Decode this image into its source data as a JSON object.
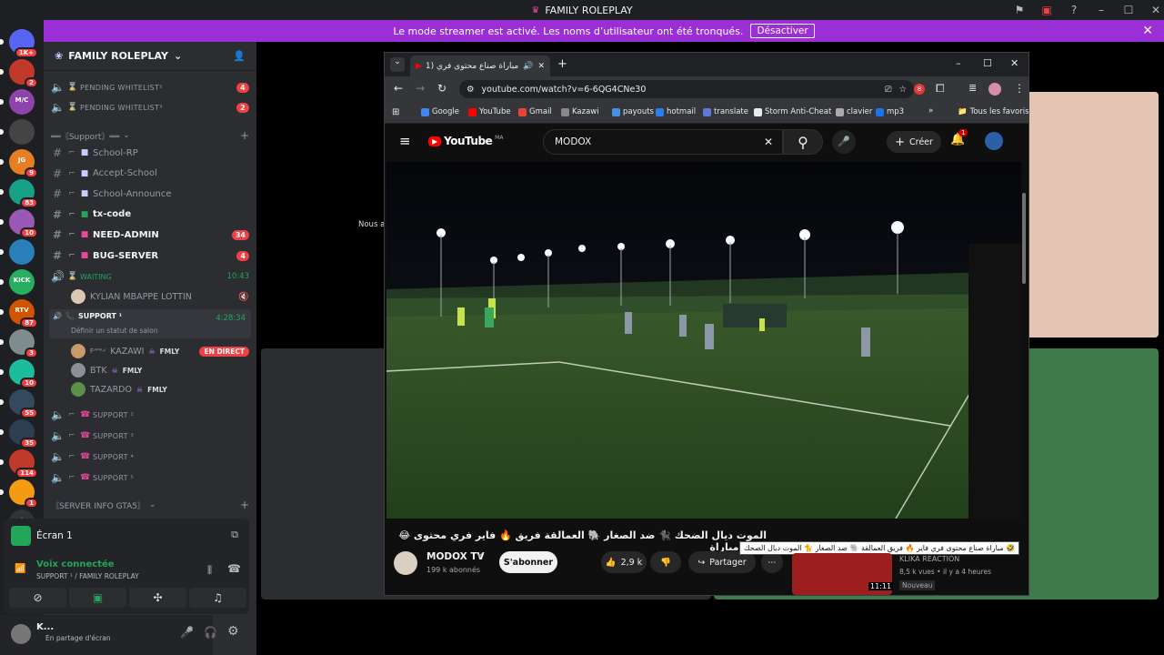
{
  "window": {
    "title": "FAMILY ROLEPLAY",
    "controls": [
      "minimize",
      "maximize",
      "close"
    ]
  },
  "banner": {
    "text": "Le mode streamer est activé. Les noms d’utilisateur ont été tronqués.",
    "button": "Désactiver"
  },
  "guilds": [
    {
      "badge": "1K+",
      "color": "#5865f2"
    },
    {
      "badge": "2",
      "color": "#c0392b"
    },
    {
      "badge": "",
      "color": "#8e44ad",
      "label": "M/C"
    },
    {
      "badge": "",
      "color": "#444"
    },
    {
      "badge": "9",
      "color": "#e67e22",
      "label": "JG"
    },
    {
      "badge": "83",
      "color": "#16a085"
    },
    {
      "badge": "10",
      "color": "#9b59b6"
    },
    {
      "badge": "",
      "color": "#2980b9"
    },
    {
      "badge": "",
      "color": "#27ae60",
      "label": "KICK"
    },
    {
      "badge": "87",
      "color": "#d35400",
      "label": "RTV"
    },
    {
      "badge": "3",
      "color": "#7f8c8d"
    },
    {
      "badge": "10",
      "color": "#1abc9c"
    },
    {
      "badge": "55",
      "color": "#34495e"
    },
    {
      "badge": "35",
      "color": "#2c3e50"
    },
    {
      "badge": "114",
      "color": "#c0392b"
    },
    {
      "badge": "1",
      "color": "#f39c12"
    }
  ],
  "sidebar": {
    "server_name": "FAMILY ROLEPLAY",
    "channels_top": [
      {
        "name": "PENDING WHITELIST²",
        "count": "4"
      },
      {
        "name": "PENDING WHITELIST³",
        "count": "2"
      }
    ],
    "category_support": "══〘Support〙══",
    "text_channels": [
      {
        "name": "School-RP",
        "bold": false,
        "count": ""
      },
      {
        "name": "Accept-School",
        "bold": false,
        "count": ""
      },
      {
        "name": "School-Announce",
        "bold": false,
        "count": ""
      },
      {
        "name": "tx-code",
        "bold": true,
        "count": ""
      },
      {
        "name": "NEED-ADMIN",
        "bold": true,
        "count": "34"
      },
      {
        "name": "BUG-SERVER",
        "bold": true,
        "count": "4"
      }
    ],
    "waiting": {
      "name": "WAITING",
      "time": "10:43"
    },
    "waiting_user": "KYLIAN MBAPPE LOTTIN",
    "support1": {
      "name": "SUPPORT ¹",
      "time": "4:28:34",
      "status": "Définir un statut de salon"
    },
    "support_users": [
      {
        "name": "KAZAWI",
        "tag": "FMLY",
        "live": "EN DIRECT",
        "prefix": "Fᴬᴹᴵᴸʸ"
      },
      {
        "name": "BTK",
        "tag": "FMLY",
        "live": ""
      },
      {
        "name": "TAZARDO",
        "tag": "FMLY",
        "live": ""
      }
    ],
    "support_channels": [
      "SUPPORT ²",
      "SUPPORT ³",
      "SUPPORT ⁴",
      "SUPPORT ⁵"
    ],
    "category_info": "〘SERVER INFO GTA5〙"
  },
  "voice": {
    "screen_label": "Écran 1",
    "connected": "Voix connectée",
    "channel": "SUPPORT ¹ / FAMILY ROLEPLAY"
  },
  "user": {
    "name": "K...",
    "status": "En partage d'écran"
  },
  "main": {
    "partial_text": "Nous av"
  },
  "browser": {
    "tab_title": "مباراة صناع محتوى فري (1)",
    "url": "youtube.com/watch?v=6-6QG4CNe30",
    "bookmarks": [
      "Google",
      "YouTube",
      "Gmail",
      "Kazawi",
      "payouts",
      "hotmail",
      "translate",
      "Storm Anti-Cheat",
      "clavier",
      "mp3"
    ],
    "all_bookmarks": "Tous les favoris",
    "extension_badge": "8"
  },
  "youtube": {
    "logo": "YouTube",
    "region": "MA",
    "search_value": "MODOX",
    "create": "Créer",
    "notif_count": "1",
    "video_title": "😂 الموت ديال الضحك 🐈‍⬛ ضد الصغار 🐘 العمالقة فريق 🔥 فاير فري محتوى صناع مباراة",
    "channel": "MODOX TV",
    "subscribers": "199 k abonnés",
    "subscribe": "S'abonner",
    "likes": "2,9 k",
    "share": "Partager",
    "tooltip": "🤣 مباراة صناع محتوى فري فاير 🔥 فريق العمالقة 🐘 ضد الصغار 🐈 الموت ديال الضحك",
    "rec": {
      "channel": "KLIKA REACTION",
      "meta": "8,5 k vues • il y a 4 heures",
      "badge": "Nouveau",
      "duration": "11:11"
    }
  }
}
